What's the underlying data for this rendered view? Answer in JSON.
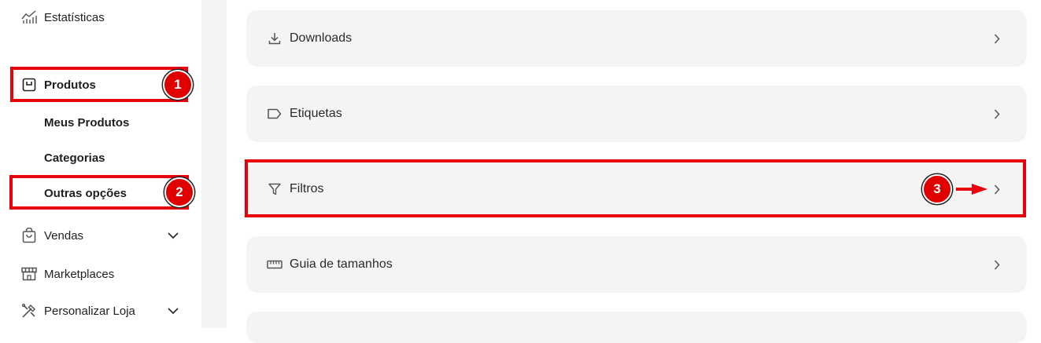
{
  "sidebar": {
    "estatisticas": "Estatísticas",
    "produtos": "Produtos",
    "meus_produtos": "Meus Produtos",
    "categorias": "Categorias",
    "outras_opcoes": "Outras opções",
    "vendas": "Vendas",
    "marketplaces": "Marketplaces",
    "personalizar_loja": "Personalizar Loja"
  },
  "cards": {
    "downloads": "Downloads",
    "etiquetas": "Etiquetas",
    "filtros": "Filtros",
    "guia": "Guia de tamanhos"
  },
  "annotations": {
    "step1": "1",
    "step2": "2",
    "step3": "3",
    "highlight_color": "#e8000b"
  }
}
